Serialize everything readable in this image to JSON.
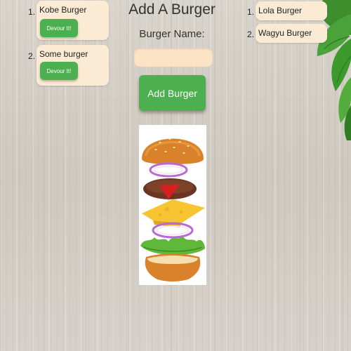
{
  "header": {
    "title": "Add A Burger"
  },
  "form": {
    "label": "Burger Name:",
    "input_value": "",
    "input_placeholder": "",
    "submit_label": "Add Burger"
  },
  "uneaten": [
    {
      "number": "1.",
      "name": "Kobe Burger",
      "action": "Devour It!"
    },
    {
      "number": "2.",
      "name": "Some burger",
      "action": "Devour It!"
    }
  ],
  "devoured": [
    {
      "number": "1.",
      "name": "Lola Burger"
    },
    {
      "number": "2.",
      "name": "Wagyu Burger"
    }
  ],
  "colors": {
    "accent_green": "#4caf50",
    "card_bg": "#fcebd4",
    "input_bg": "#fce3c6"
  }
}
